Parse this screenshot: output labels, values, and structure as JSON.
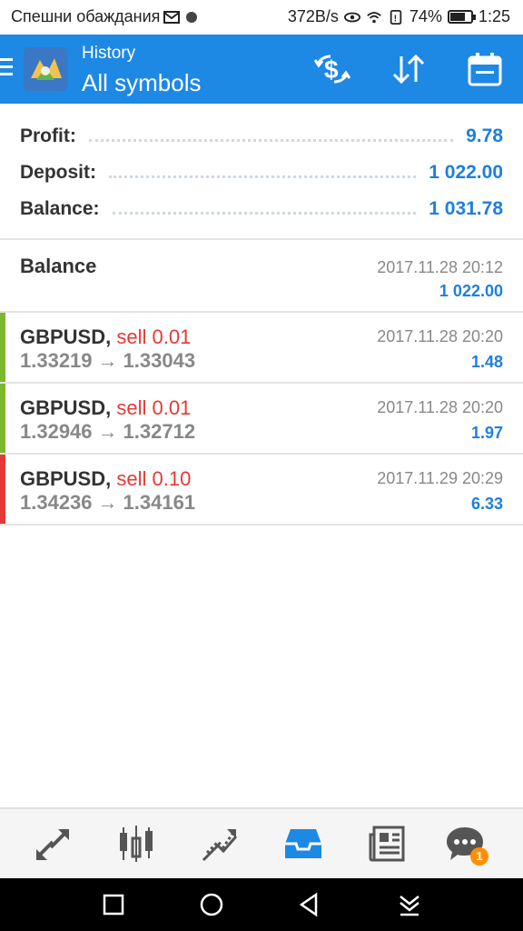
{
  "status_bar": {
    "carrier_text": "Спешни обаждания",
    "net_speed": "372B/s",
    "battery": "74%",
    "battery_level": 0.74,
    "time": "1:25"
  },
  "app_bar": {
    "subtitle": "History",
    "title": "All symbols"
  },
  "summary": {
    "profit_label": "Profit:",
    "profit_value": "9.78",
    "deposit_label": "Deposit:",
    "deposit_value": "1 022.00",
    "balance_label": "Balance:",
    "balance_value": "1 031.78"
  },
  "balance_entry": {
    "title": "Balance",
    "time": "2017.11.28 20:12",
    "amount": "1 022.00"
  },
  "trades": [
    {
      "symbol": "GBPUSD,",
      "action": "sell 0.01",
      "open_price": "1.33219",
      "arrow": "→",
      "close_price": "1.33043",
      "time": "2017.11.28 20:20",
      "profit": "1.48",
      "marker_color": "#7cb82f"
    },
    {
      "symbol": "GBPUSD,",
      "action": "sell 0.01",
      "open_price": "1.32946",
      "arrow": "→",
      "close_price": "1.32712",
      "time": "2017.11.28 20:20",
      "profit": "1.97",
      "marker_color": "#7cb82f"
    },
    {
      "symbol": "GBPUSD,",
      "action": "sell 0.10",
      "open_price": "1.34236",
      "arrow": "→",
      "close_price": "1.34161",
      "time": "2017.11.29 20:29",
      "profit": "6.33",
      "marker_color": "#e53935"
    }
  ],
  "bottom_nav": {
    "items": [
      "quotes-icon",
      "chart-icon",
      "trade-icon",
      "history-icon",
      "news-icon",
      "messages-icon"
    ],
    "active": "history-icon",
    "messages_badge": "1"
  },
  "colors": {
    "accent": "#1e88e5",
    "value_blue": "#1e7fe0",
    "sell_red": "#e53935"
  }
}
